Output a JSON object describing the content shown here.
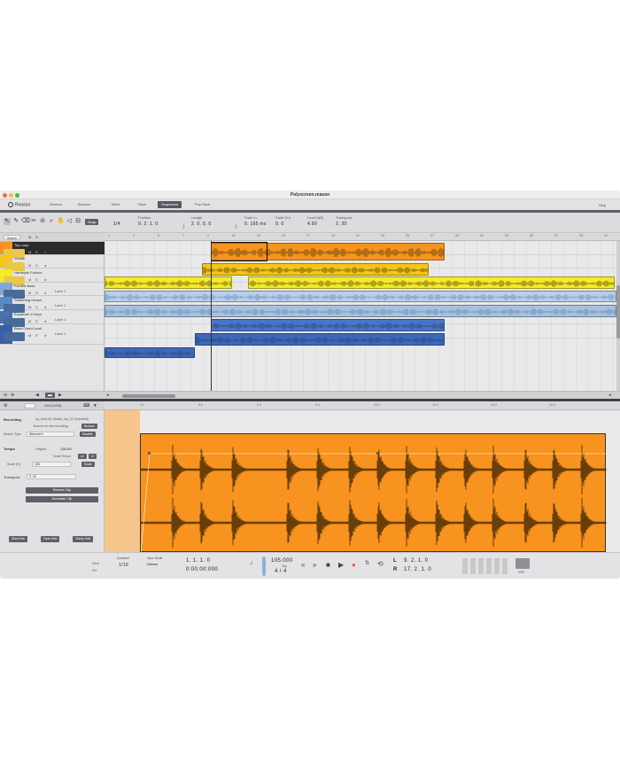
{
  "window": {
    "title": "Polyscreen.reason"
  },
  "nav": {
    "logo": "Reason",
    "tabs": [
      "Devices",
      "Browser",
      "Mixer",
      "Rack",
      "Sequencer",
      "Pop Rack"
    ],
    "active_tab": "Sequencer",
    "help": "Help"
  },
  "toolbar": {
    "snap_button": "Snap",
    "quantize": "1/4",
    "position": {
      "label": "Position",
      "value": "9. 2. 1.  0"
    },
    "length": {
      "label": "Length",
      "value": "2. 0. 0.  0"
    },
    "fade_in": {
      "label": "Fade In",
      "value": "0. 195 ms"
    },
    "fade_out": {
      "label": "Fade Out",
      "value": "0. 0"
    },
    "level": {
      "label": "Level (dB)",
      "value": "4.99"
    },
    "transpose": {
      "label": "Transpose",
      "value": "2. 20"
    }
  },
  "tracklist": {
    "header_button": "Search",
    "tracks": [
      {
        "name": "Top Loop",
        "color": "#f7931e"
      },
      {
        "name": "Vocals",
        "color": "#f5c518"
      },
      {
        "name": "Hardstyle Furious",
        "color": "#f4ea2a"
      },
      {
        "name": "Fat 80s Bass",
        "color": "#7ea7d8",
        "lane": "Lane 1"
      },
      {
        "name": "Shattering House",
        "color": "#5a8ac6",
        "lane": "Lane 1"
      },
      {
        "name": "Expander X Keys",
        "color": "#4a6fb5",
        "lane": "Lane 1"
      },
      {
        "name": "Bass Chord Lead",
        "color": "#3a5ea8",
        "lane": "Lane 1"
      }
    ],
    "mute": "M",
    "solo": "S"
  },
  "ruler_ticks": [
    "1",
    "3",
    "5",
    "7",
    "9",
    "11",
    "13",
    "15",
    "17",
    "19",
    "21",
    "23",
    "25",
    "27",
    "29",
    "31",
    "33",
    "35",
    "37",
    "39",
    "41"
  ],
  "editor": {
    "quantize": "Grid (1/16)",
    "recording_label": "Recording",
    "recording_value": "ep_drm128_vibrato_top_02 (Imported)",
    "record_new_btn": "Bounce to new recording",
    "browse_btn": "Browse",
    "stretch_type_label": "Stretch Type",
    "stretch_type_value": "Allround",
    "disable_btn": "Disable",
    "tempo_label": "Tempo",
    "original_label": "Original",
    "original_value": "128.000",
    "scale_tempo_label": "Scale Tempo",
    "scale_label": "Scale (%)",
    "scale_value": "100",
    "scale_x2": "x2",
    "scale_div2": "/2",
    "scale_btn": "Scale",
    "transpose_label": "Transpose",
    "transpose_value": "2. 20",
    "reverse_btn": "Reverse Clip",
    "normalize_btn": "Normalize Clip",
    "bottom_buttons": [
      "Slice Edit",
      "Fade Edit",
      "Clamp Edit"
    ],
    "ruler_ticks": [
      "9.1",
      "9.2",
      "9.3",
      "9.4",
      "10.1",
      "10.2",
      "10.3",
      "10.4"
    ]
  },
  "transport": {
    "quantize_label": "Quantize",
    "quantize_value": "1/16",
    "click_label": "Click",
    "precount_label": "Pre",
    "sync_label": "Sync Mode",
    "sync_value": "Internal",
    "position_bars": "1.  1.  1.  0",
    "position_time": "0:00:00:000",
    "tempo": "105.000",
    "tempo_label": "Tap",
    "signature": "4 / 4",
    "loop_left_label": "L",
    "loop_left": "9.  2.  1.  0",
    "loop_right_label": "R",
    "loop_right": "17.  2.  1.  0",
    "dsp_label": "DSP"
  }
}
